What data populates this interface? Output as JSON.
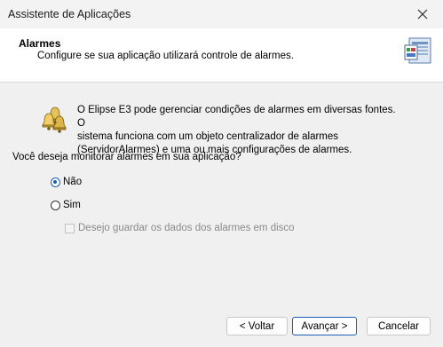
{
  "window": {
    "title": "Assistente de Aplicações"
  },
  "header": {
    "title": "Alarmes",
    "subtitle": "Configure se sua aplicação utilizará controle de alarmes."
  },
  "content": {
    "description_lines": [
      "O Elipse E3 pode gerenciar condições de alarmes em diversas fontes. O",
      "sistema funciona com um objeto centralizador de alarmes",
      "(ServidorAlarmes) e uma ou mais configurações de alarmes."
    ],
    "question": "Você deseja monitorar alarmes em sua aplicação?",
    "options": [
      {
        "label": "Não",
        "selected": true
      },
      {
        "label": "Sim",
        "selected": false
      }
    ],
    "save_alarms_checkbox": {
      "label": "Desejo guardar os dados dos alarmes em disco",
      "checked": false,
      "enabled": false
    }
  },
  "buttons": {
    "back": "< Voltar",
    "next": "Avançar >",
    "cancel": "Cancelar"
  },
  "colors": {
    "accent": "#1a5fb4",
    "disabled_text": "#8a8a8a"
  },
  "icons": {
    "close": "close-icon",
    "header": "wizard-panel-icon",
    "alarm": "alarm-bells-icon"
  }
}
